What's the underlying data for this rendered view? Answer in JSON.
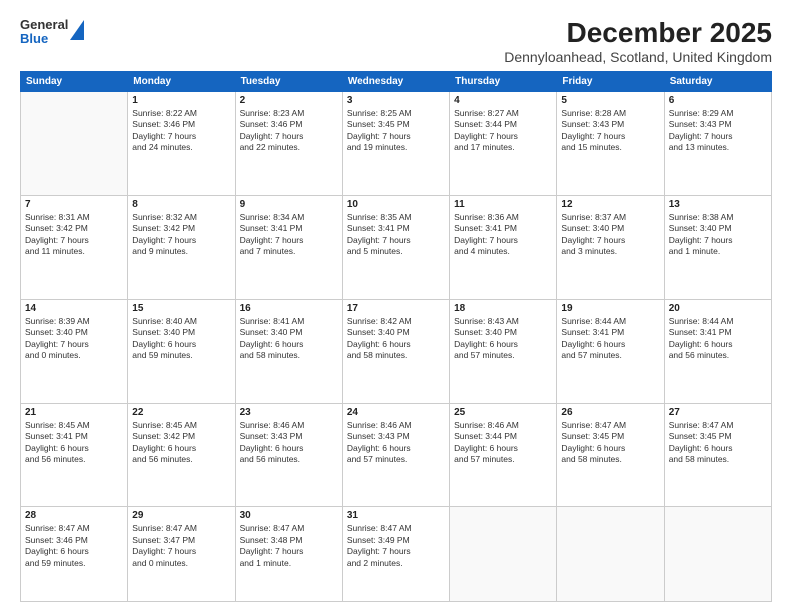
{
  "logo": {
    "general": "General",
    "blue": "Blue"
  },
  "title": "December 2025",
  "subtitle": "Dennyloanhead, Scotland, United Kingdom",
  "headers": [
    "Sunday",
    "Monday",
    "Tuesday",
    "Wednesday",
    "Thursday",
    "Friday",
    "Saturday"
  ],
  "weeks": [
    [
      {
        "day": "",
        "info": ""
      },
      {
        "day": "1",
        "info": "Sunrise: 8:22 AM\nSunset: 3:46 PM\nDaylight: 7 hours\nand 24 minutes."
      },
      {
        "day": "2",
        "info": "Sunrise: 8:23 AM\nSunset: 3:46 PM\nDaylight: 7 hours\nand 22 minutes."
      },
      {
        "day": "3",
        "info": "Sunrise: 8:25 AM\nSunset: 3:45 PM\nDaylight: 7 hours\nand 19 minutes."
      },
      {
        "day": "4",
        "info": "Sunrise: 8:27 AM\nSunset: 3:44 PM\nDaylight: 7 hours\nand 17 minutes."
      },
      {
        "day": "5",
        "info": "Sunrise: 8:28 AM\nSunset: 3:43 PM\nDaylight: 7 hours\nand 15 minutes."
      },
      {
        "day": "6",
        "info": "Sunrise: 8:29 AM\nSunset: 3:43 PM\nDaylight: 7 hours\nand 13 minutes."
      }
    ],
    [
      {
        "day": "7",
        "info": "Sunrise: 8:31 AM\nSunset: 3:42 PM\nDaylight: 7 hours\nand 11 minutes."
      },
      {
        "day": "8",
        "info": "Sunrise: 8:32 AM\nSunset: 3:42 PM\nDaylight: 7 hours\nand 9 minutes."
      },
      {
        "day": "9",
        "info": "Sunrise: 8:34 AM\nSunset: 3:41 PM\nDaylight: 7 hours\nand 7 minutes."
      },
      {
        "day": "10",
        "info": "Sunrise: 8:35 AM\nSunset: 3:41 PM\nDaylight: 7 hours\nand 5 minutes."
      },
      {
        "day": "11",
        "info": "Sunrise: 8:36 AM\nSunset: 3:41 PM\nDaylight: 7 hours\nand 4 minutes."
      },
      {
        "day": "12",
        "info": "Sunrise: 8:37 AM\nSunset: 3:40 PM\nDaylight: 7 hours\nand 3 minutes."
      },
      {
        "day": "13",
        "info": "Sunrise: 8:38 AM\nSunset: 3:40 PM\nDaylight: 7 hours\nand 1 minute."
      }
    ],
    [
      {
        "day": "14",
        "info": "Sunrise: 8:39 AM\nSunset: 3:40 PM\nDaylight: 7 hours\nand 0 minutes."
      },
      {
        "day": "15",
        "info": "Sunrise: 8:40 AM\nSunset: 3:40 PM\nDaylight: 6 hours\nand 59 minutes."
      },
      {
        "day": "16",
        "info": "Sunrise: 8:41 AM\nSunset: 3:40 PM\nDaylight: 6 hours\nand 58 minutes."
      },
      {
        "day": "17",
        "info": "Sunrise: 8:42 AM\nSunset: 3:40 PM\nDaylight: 6 hours\nand 58 minutes."
      },
      {
        "day": "18",
        "info": "Sunrise: 8:43 AM\nSunset: 3:40 PM\nDaylight: 6 hours\nand 57 minutes."
      },
      {
        "day": "19",
        "info": "Sunrise: 8:44 AM\nSunset: 3:41 PM\nDaylight: 6 hours\nand 57 minutes."
      },
      {
        "day": "20",
        "info": "Sunrise: 8:44 AM\nSunset: 3:41 PM\nDaylight: 6 hours\nand 56 minutes."
      }
    ],
    [
      {
        "day": "21",
        "info": "Sunrise: 8:45 AM\nSunset: 3:41 PM\nDaylight: 6 hours\nand 56 minutes."
      },
      {
        "day": "22",
        "info": "Sunrise: 8:45 AM\nSunset: 3:42 PM\nDaylight: 6 hours\nand 56 minutes."
      },
      {
        "day": "23",
        "info": "Sunrise: 8:46 AM\nSunset: 3:43 PM\nDaylight: 6 hours\nand 56 minutes."
      },
      {
        "day": "24",
        "info": "Sunrise: 8:46 AM\nSunset: 3:43 PM\nDaylight: 6 hours\nand 57 minutes."
      },
      {
        "day": "25",
        "info": "Sunrise: 8:46 AM\nSunset: 3:44 PM\nDaylight: 6 hours\nand 57 minutes."
      },
      {
        "day": "26",
        "info": "Sunrise: 8:47 AM\nSunset: 3:45 PM\nDaylight: 6 hours\nand 58 minutes."
      },
      {
        "day": "27",
        "info": "Sunrise: 8:47 AM\nSunset: 3:45 PM\nDaylight: 6 hours\nand 58 minutes."
      }
    ],
    [
      {
        "day": "28",
        "info": "Sunrise: 8:47 AM\nSunset: 3:46 PM\nDaylight: 6 hours\nand 59 minutes."
      },
      {
        "day": "29",
        "info": "Sunrise: 8:47 AM\nSunset: 3:47 PM\nDaylight: 7 hours\nand 0 minutes."
      },
      {
        "day": "30",
        "info": "Sunrise: 8:47 AM\nSunset: 3:48 PM\nDaylight: 7 hours\nand 1 minute."
      },
      {
        "day": "31",
        "info": "Sunrise: 8:47 AM\nSunset: 3:49 PM\nDaylight: 7 hours\nand 2 minutes."
      },
      {
        "day": "",
        "info": ""
      },
      {
        "day": "",
        "info": ""
      },
      {
        "day": "",
        "info": ""
      }
    ]
  ]
}
